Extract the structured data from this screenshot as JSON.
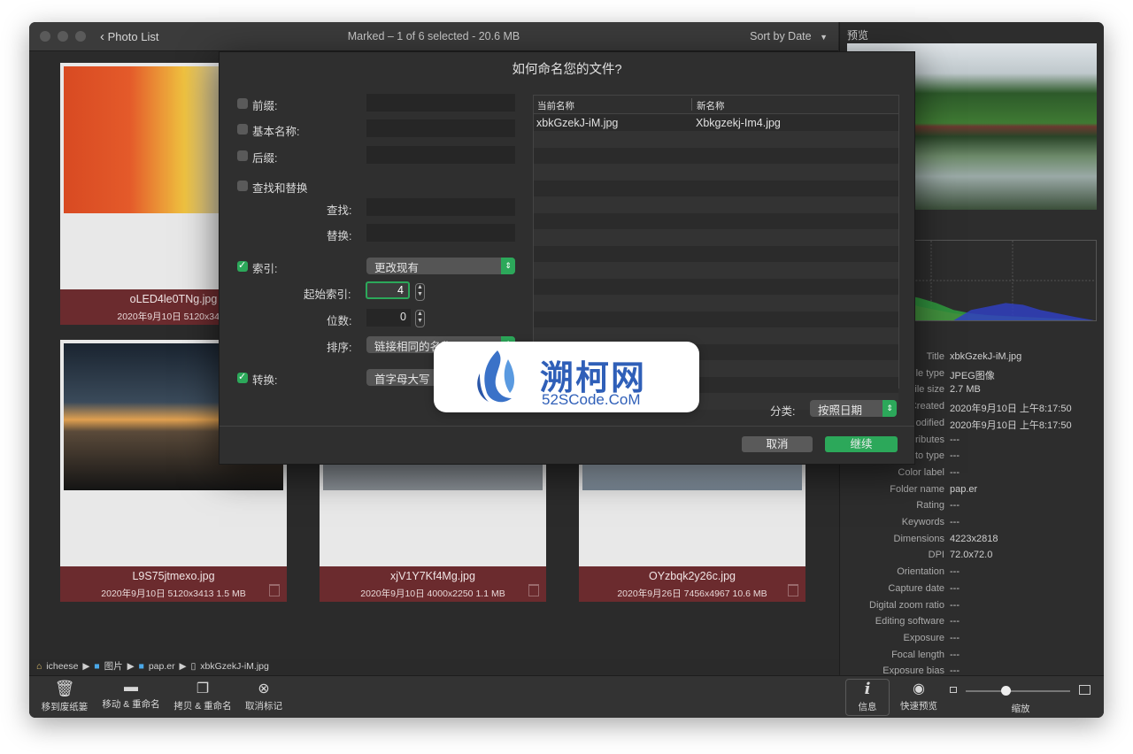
{
  "window": {
    "back_label": "Photo List",
    "title": "Marked – 1 of 6 selected - 20.6 MB",
    "sort_label": "Sort by Date"
  },
  "cards": [
    {
      "name": "oLED4le0TNg.jpg",
      "meta": "2020年9月10日  5120x3414"
    },
    {
      "name": "L9S75jtmexo.jpg",
      "meta": "2020年9月10日  5120x3413  1.5 MB"
    },
    {
      "name": "xjV1Y7Kf4Mg.jpg",
      "meta": "2020年9月10日  4000x2250  1.1 MB"
    },
    {
      "name": "OYzbqk2y26c.jpg",
      "meta": "2020年9月26日  7456x4967  10.6 MB"
    }
  ],
  "path": [
    "icheese",
    "图片",
    "pap.er",
    "xbkGzekJ-iM.jpg"
  ],
  "toolbar": {
    "trash": "移到废纸篓",
    "move_rename": "移动 & 重命名",
    "copy_rename": "拷贝 & 重命名",
    "unmark": "取消标记",
    "info": "信息",
    "quicklook": "快速预览",
    "zoom": "缩放"
  },
  "right_panel": {
    "preview_label": "预览",
    "info": [
      {
        "k": "Title",
        "v": "xbkGzekJ-iM.jpg"
      },
      {
        "k": "File type",
        "v": "JPEG图像"
      },
      {
        "k": "File size",
        "v": "2.7 MB"
      },
      {
        "k": "Created",
        "v": "2020年9月10日 上午8:17:50"
      },
      {
        "k": "Modified",
        "v": "2020年9月10日 上午8:17:50"
      },
      {
        "k": "Attributes",
        "v": "---"
      },
      {
        "k": "Photo type",
        "v": "---"
      },
      {
        "k": "Color label",
        "v": "---"
      },
      {
        "k": "Folder name",
        "v": "pap.er"
      },
      {
        "k": "Rating",
        "v": "---"
      },
      {
        "k": "Keywords",
        "v": "---"
      },
      {
        "k": "Dimensions",
        "v": "4223x2818"
      },
      {
        "k": "DPI",
        "v": "72.0x72.0"
      },
      {
        "k": "Orientation",
        "v": "---"
      },
      {
        "k": "Capture date",
        "v": "---"
      },
      {
        "k": "Digital zoom ratio",
        "v": "---"
      },
      {
        "k": "Editing software",
        "v": "---"
      },
      {
        "k": "Exposure",
        "v": "---"
      },
      {
        "k": "Focal length",
        "v": "---"
      },
      {
        "k": "Exposure bias",
        "v": "---"
      }
    ]
  },
  "dialog": {
    "title": "如何命名您的文件?",
    "prefix": "前缀:",
    "base_name": "基本名称:",
    "suffix": "后缀:",
    "find_replace": "查找和替换",
    "find": "查找:",
    "replace": "替换:",
    "index": "索引:",
    "index_mode": "更改现有",
    "start_index": "起始索引:",
    "start_index_value": "4",
    "digits": "位数:",
    "digits_value": "0",
    "order": "排序:",
    "order_value": "链接相同的名称",
    "convert": "转换:",
    "convert_value": "首字母大写",
    "col_current": "当前名称",
    "col_new": "新名称",
    "row_current": "xbkGzekJ-iM.jpg",
    "row_new": "Xbkgzekj-Im4.jpg",
    "sort_label": "分类:",
    "sort_value": "按照日期",
    "cancel": "取消",
    "continue": "继续"
  },
  "watermark": {
    "title": "溯柯网",
    "sub": "52SCode.CoM"
  }
}
